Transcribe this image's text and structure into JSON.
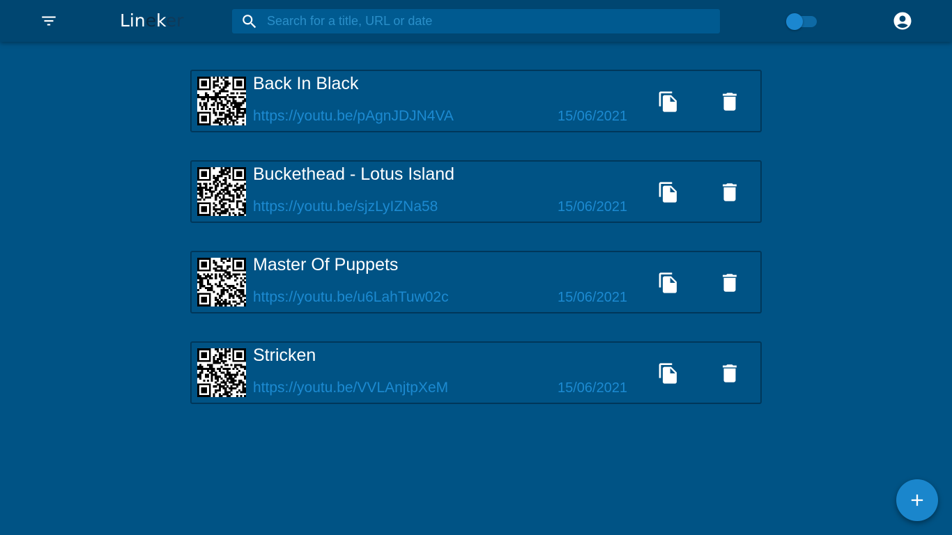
{
  "app": {
    "logo_parts": [
      "Lin",
      "e",
      "k",
      "er"
    ]
  },
  "search": {
    "placeholder": "Search for a title, URL or date",
    "value": ""
  },
  "theme_toggle": {
    "state": "off"
  },
  "icons": {
    "menu": "filter-list-icon",
    "search": "search-icon",
    "account": "account-circle-icon",
    "copy": "copy-icon",
    "delete": "trash-icon",
    "add": "plus-icon",
    "qr": "qr-code-icon"
  },
  "colors": {
    "background": "#005385",
    "appbar": "#004671",
    "accent": "#1c8ad1",
    "text": "#ffffff"
  },
  "links": [
    {
      "title": "Back In Black",
      "url": "https://youtu.be/pAgnJDJN4VA",
      "date": "15/06/2021"
    },
    {
      "title": "Buckethead - Lotus Island",
      "url": "https://youtu.be/sjzLyIZNa58",
      "date": "15/06/2021"
    },
    {
      "title": "Master Of Puppets",
      "url": "https://youtu.be/u6LahTuw02c",
      "date": "15/06/2021"
    },
    {
      "title": "Stricken",
      "url": "https://youtu.be/VVLAnjtpXeM",
      "date": "15/06/2021"
    }
  ]
}
